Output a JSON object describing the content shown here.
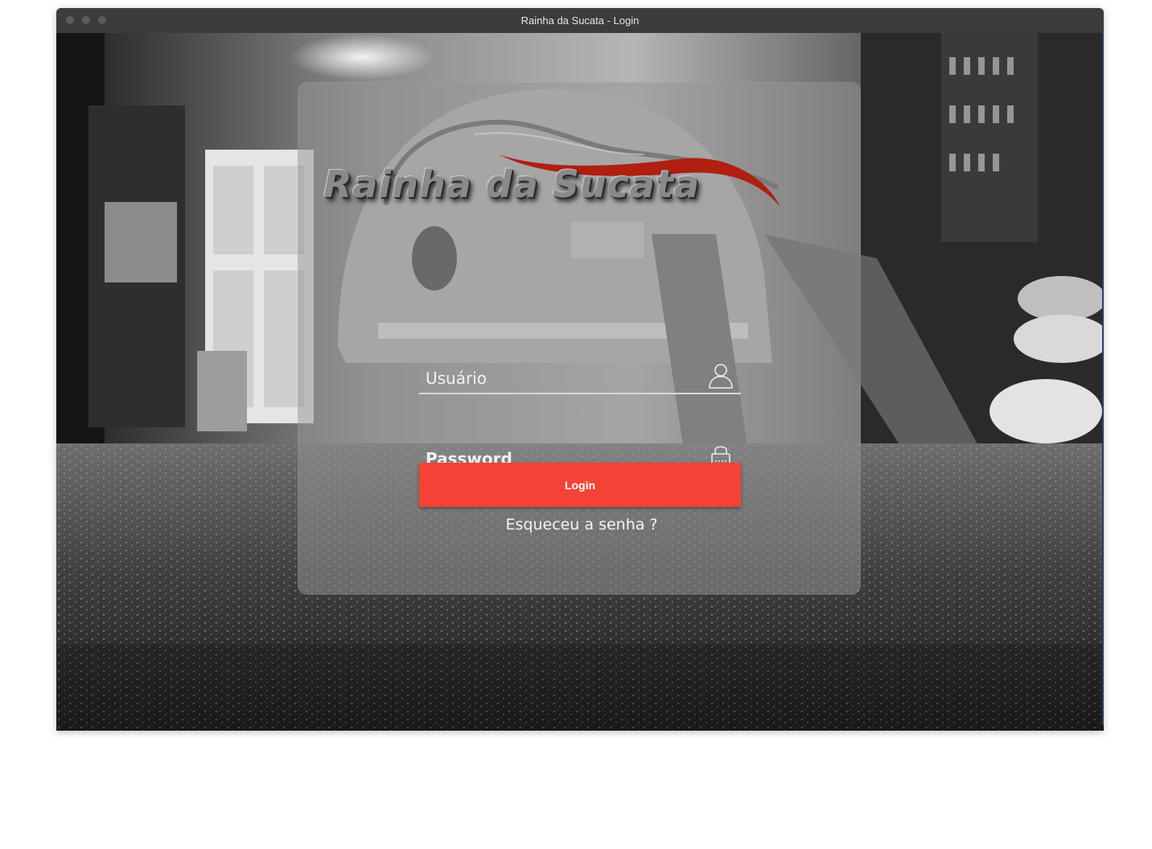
{
  "window": {
    "title": "Rainha da Sucata - Login"
  },
  "logo": {
    "text": "Rainha da Sucata",
    "icon": "car-swoosh-logo"
  },
  "form": {
    "username_placeholder": "Usuário",
    "password_placeholder": "Password",
    "username_icon": "user-icon",
    "password_icon": "lock-icon"
  },
  "actions": {
    "login_label": "Login",
    "forgot_label": "Esqueceu a senha ?"
  },
  "colors": {
    "accent": "#f44336",
    "logo_swoosh": "#b01f10",
    "titlebar": "#3c3c3c"
  }
}
